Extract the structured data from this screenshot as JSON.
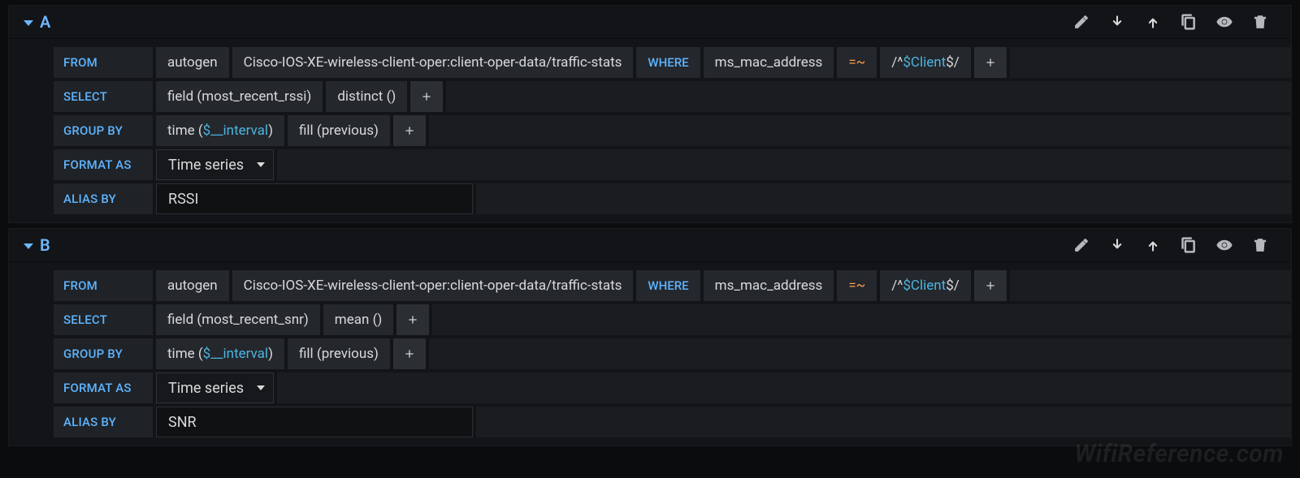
{
  "watermark": "WifiReference.com",
  "queries": [
    {
      "letter": "A",
      "from": {
        "label": "FROM",
        "policy": "autogen",
        "measurement": "Cisco-IOS-XE-wireless-client-oper:client-oper-data/traffic-stats",
        "where_label": "WHERE",
        "where_field": "ms_mac_address",
        "where_op": "=~",
        "where_value_pre": "/^",
        "where_value_var": "$Client",
        "where_value_post": "$/"
      },
      "select": {
        "label": "SELECT",
        "field": "field (most_recent_rssi)",
        "agg": "distinct ()"
      },
      "groupby": {
        "label": "GROUP BY",
        "time_pre": "time (",
        "time_var": "$__interval",
        "time_post": ")",
        "fill": "fill (previous)"
      },
      "format": {
        "label": "FORMAT AS",
        "value": "Time series"
      },
      "alias": {
        "label": "ALIAS BY",
        "value": "RSSI"
      }
    },
    {
      "letter": "B",
      "from": {
        "label": "FROM",
        "policy": "autogen",
        "measurement": "Cisco-IOS-XE-wireless-client-oper:client-oper-data/traffic-stats",
        "where_label": "WHERE",
        "where_field": "ms_mac_address",
        "where_op": "=~",
        "where_value_pre": "/^",
        "where_value_var": "$Client",
        "where_value_post": "$/"
      },
      "select": {
        "label": "SELECT",
        "field": "field (most_recent_snr)",
        "agg": "mean ()"
      },
      "groupby": {
        "label": "GROUP BY",
        "time_pre": "time (",
        "time_var": "$__interval",
        "time_post": ")",
        "fill": "fill (previous)"
      },
      "format": {
        "label": "FORMAT AS",
        "value": "Time series"
      },
      "alias": {
        "label": "ALIAS BY",
        "value": "SNR"
      }
    }
  ]
}
